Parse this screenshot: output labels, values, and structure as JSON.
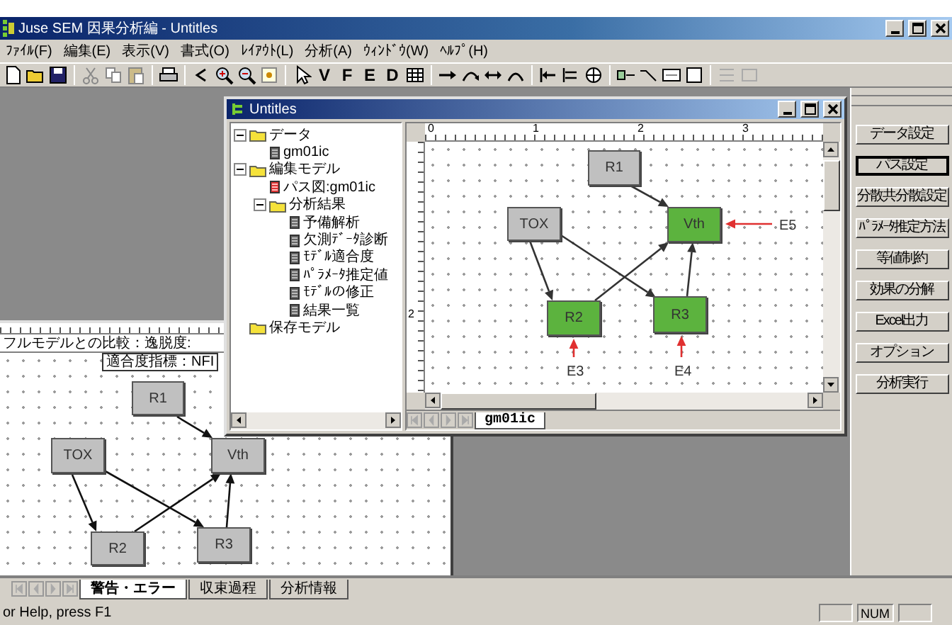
{
  "window": {
    "title": "Juse SEM 因果分析編 - Untitles"
  },
  "menu": [
    "ﾌｧｲﾙ(F)",
    "編集(E)",
    "表示(V)",
    "書式(O)",
    "ﾚｲｱｳﾄ(L)",
    "分析(A)",
    "ｳｨﾝﾄﾞｳ(W)",
    "ﾍﾙﾌﾟ(H)"
  ],
  "toolbar": {
    "letters": [
      "V",
      "F",
      "E",
      "D"
    ]
  },
  "background_window": {
    "comparison_text": "フルモデルとの比較：逸脱度:",
    "fit_index_label": "適合度指標：NFI",
    "nodes": [
      {
        "label": "R1",
        "color": "#c0c0c0"
      },
      {
        "label": "TOX",
        "color": "#c0c0c0"
      },
      {
        "label": "Vth",
        "color": "#c0c0c0"
      },
      {
        "label": "R2",
        "color": "#c0c0c0"
      },
      {
        "label": "R3",
        "color": "#c0c0c0"
      }
    ]
  },
  "document_window": {
    "title": "Untitles",
    "tree": [
      {
        "label": "データ",
        "kind": "folder",
        "expanded": true,
        "children": [
          {
            "label": "gm01ic",
            "kind": "file"
          }
        ]
      },
      {
        "label": "編集モデル",
        "kind": "folder",
        "expanded": true,
        "children": [
          {
            "label": "パス図:gm01ic",
            "kind": "diagram"
          },
          {
            "label": "分析結果",
            "kind": "folder",
            "expanded": true,
            "children": [
              {
                "label": "予備解析",
                "kind": "file"
              },
              {
                "label": "欠測ﾃﾞｰﾀ診断",
                "kind": "file"
              },
              {
                "label": "ﾓﾃﾞﾙ適合度",
                "kind": "file"
              },
              {
                "label": "ﾊﾟﾗﾒｰﾀ推定値",
                "kind": "file"
              },
              {
                "label": "ﾓﾃﾞﾙの修正",
                "kind": "file"
              },
              {
                "label": "結果一覧",
                "kind": "file"
              }
            ]
          }
        ]
      },
      {
        "label": "保存モデル",
        "kind": "folder"
      }
    ],
    "ruler_labels": [
      "0",
      "1",
      "2",
      "3"
    ],
    "vertical_ruler_labels": [
      "2"
    ],
    "nodes": [
      {
        "label": "R1",
        "color": "#c0c0c0"
      },
      {
        "label": "TOX",
        "color": "#c0c0c0"
      },
      {
        "label": "Vth",
        "color": "#5cb33e"
      },
      {
        "label": "R2",
        "color": "#5cb33e"
      },
      {
        "label": "R3",
        "color": "#5cb33e"
      }
    ],
    "error_terms": [
      "E5",
      "E3",
      "E4"
    ],
    "sheet_tabs": [
      {
        "label": "gm01ic",
        "selected": true
      }
    ]
  },
  "side_buttons": [
    {
      "label": "データ設定",
      "selected": false
    },
    {
      "label": "パス設定",
      "selected": true
    },
    {
      "label": "分散共分散設定",
      "selected": false
    },
    {
      "label": "ﾊﾟﾗﾒｰﾀ推定方法",
      "selected": false
    },
    {
      "label": "等値制約",
      "selected": false
    },
    {
      "label": "効果の分解",
      "selected": false
    },
    {
      "label": "Excel出力",
      "selected": false
    },
    {
      "label": "オプション",
      "selected": false
    },
    {
      "label": "分析実行",
      "selected": false
    }
  ],
  "output_tabs": [
    {
      "label": "警告・エラー",
      "selected": true
    },
    {
      "label": "収束過程",
      "selected": false
    },
    {
      "label": "分析情報",
      "selected": false
    }
  ],
  "status_bar": {
    "message": "or Help, press F1",
    "indicators": [
      "NUM"
    ]
  }
}
